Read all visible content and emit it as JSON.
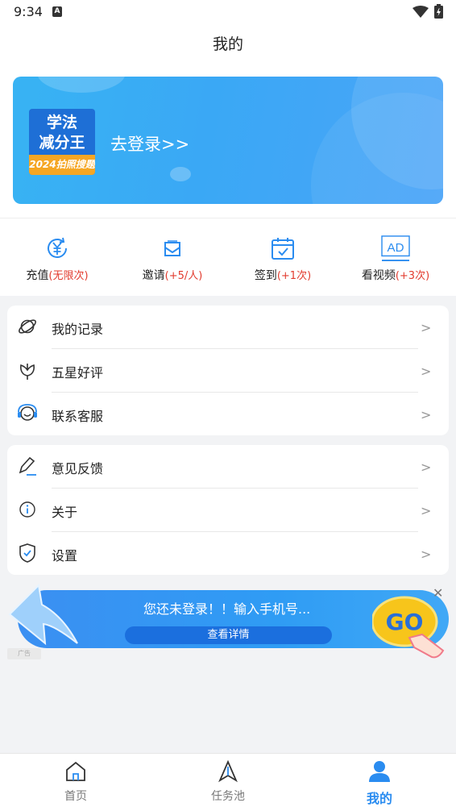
{
  "status_bar": {
    "time": "9:34",
    "notification_icon": "A"
  },
  "title": "我的",
  "banner": {
    "app_icon": {
      "line1": "学法",
      "line2": "减分王",
      "line3": "2024拍照搜题"
    },
    "login_text": "去登录>>"
  },
  "quick_actions": [
    {
      "label": "充值",
      "extra": "(无限次)",
      "icon": "yuan-refresh-icon"
    },
    {
      "label": "邀请",
      "extra": "(+5/人)",
      "icon": "envelope-icon"
    },
    {
      "label": "签到",
      "extra": "(+1次)",
      "icon": "calendar-check-icon"
    },
    {
      "label": "看视频",
      "extra": "(+3次)",
      "icon": "ad-video-icon"
    }
  ],
  "menu_group1": [
    {
      "label": "我的记录",
      "icon": "planet-icon"
    },
    {
      "label": "五星好评",
      "icon": "lotus-icon"
    },
    {
      "label": "联系客服",
      "icon": "headset-icon"
    }
  ],
  "menu_group2": [
    {
      "label": "意见反馈",
      "icon": "pen-icon"
    },
    {
      "label": "关于",
      "icon": "info-icon"
    },
    {
      "label": "设置",
      "icon": "shield-check-icon"
    }
  ],
  "chevron": ">",
  "ad": {
    "title": "您还未登录！！输入手机号...",
    "button": "查看详情",
    "tag": "广告",
    "go": "GO",
    "close": "✕"
  },
  "tabs": [
    {
      "label": "首页",
      "icon": "home-icon",
      "active": false
    },
    {
      "label": "任务池",
      "icon": "navigation-arrow-icon",
      "active": false
    },
    {
      "label": "我的",
      "icon": "person-icon",
      "active": true
    }
  ],
  "colors": {
    "accent": "#2a8cf0",
    "banner": "#3aa8f5",
    "red_extra": "#e23b2e",
    "ad_go": "#f7c51b"
  }
}
